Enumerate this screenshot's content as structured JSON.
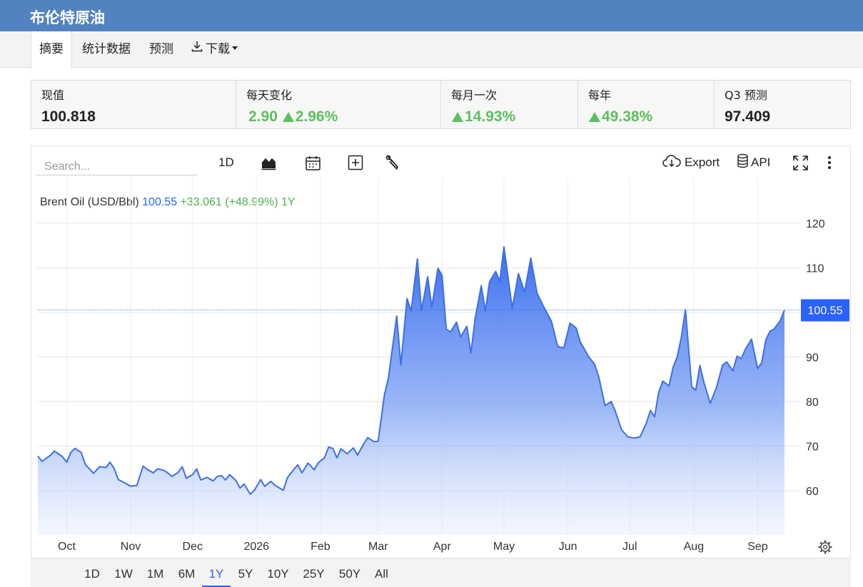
{
  "title": "布伦特原油",
  "tabs": [
    {
      "label": "摘要",
      "active": true
    },
    {
      "label": "统计数据"
    },
    {
      "label": "预测"
    },
    {
      "label": "下载",
      "icon": "download-icon",
      "has_dropdown": true
    }
  ],
  "stats": [
    {
      "label": "现值",
      "value": "100.818"
    },
    {
      "label": "每天变化",
      "value": "2.90",
      "value2": "2.96%",
      "direction": "up"
    },
    {
      "label": "每月一次",
      "value": "14.93%",
      "direction": "up"
    },
    {
      "label": "每年",
      "value": "49.38%",
      "direction": "up"
    },
    {
      "label": "Q3 预测",
      "value": "97.409"
    }
  ],
  "toolbar": {
    "search_placeholder": "Search...",
    "interval": "1D",
    "chart_type_icon": "area-chart-icon",
    "calendar_icon": "calendar-icon",
    "compare_icon": "plus-square-icon",
    "settings_icon": "wrench-icon",
    "export_label": "Export",
    "export_icon": "cloud-download-icon",
    "api_label": "API",
    "api_icon": "database-icon",
    "fullscreen_icon": "fullscreen-icon",
    "more_icon": "more-vertical-icon"
  },
  "legend": {
    "name": "Brent Oil (USD/Bbl)",
    "last": "100.55",
    "change": "+33.061",
    "change_pct": "(+48.99%)",
    "period": "1Y"
  },
  "ranges": [
    "1D",
    "1W",
    "1M",
    "6M",
    "1Y",
    "5Y",
    "10Y",
    "25Y",
    "50Y",
    "All"
  ],
  "active_range": "1Y",
  "colors": {
    "header": "#5283c0",
    "line": "#3d6fe3",
    "price_tag": "#2962ff",
    "positive": "#5cc05c"
  },
  "chart_data": {
    "type": "area",
    "series_name": "Brent Oil (USD/Bbl)",
    "x_range": [
      "2025-09-17",
      "2026-09-14"
    ],
    "x_ticks": [
      {
        "label": "Oct",
        "date": "2025-10-01"
      },
      {
        "label": "Nov",
        "date": "2025-11-01"
      },
      {
        "label": "Dec",
        "date": "2025-12-01"
      },
      {
        "label": "2026",
        "date": "2026-01-01"
      },
      {
        "label": "Feb",
        "date": "2026-02-01"
      },
      {
        "label": "Mar",
        "date": "2026-03-01"
      },
      {
        "label": "Apr",
        "date": "2026-04-01"
      },
      {
        "label": "May",
        "date": "2026-05-01"
      },
      {
        "label": "Jun",
        "date": "2026-06-01"
      },
      {
        "label": "Jul",
        "date": "2026-07-01"
      },
      {
        "label": "Aug",
        "date": "2026-08-01"
      },
      {
        "label": "Sep",
        "date": "2026-09-01"
      }
    ],
    "y_ticks": [
      60,
      70,
      80,
      90,
      100,
      110,
      120
    ],
    "y_tick_labels": [
      "60",
      "70",
      "80",
      "90",
      "110",
      "120"
    ],
    "ylim": [
      50.8,
      126.3
    ],
    "last_value": 100.55,
    "last_label": "100.55",
    "grid": true,
    "points": [
      [
        "2025-09-17",
        67.8
      ],
      [
        "2025-09-19",
        66.6
      ],
      [
        "2025-09-23",
        67.9
      ],
      [
        "2025-09-25",
        68.9
      ],
      [
        "2025-09-29",
        67.6
      ],
      [
        "2025-10-01",
        66.4
      ],
      [
        "2025-10-03",
        68.6
      ],
      [
        "2025-10-05",
        69.5
      ],
      [
        "2025-10-08",
        68.6
      ],
      [
        "2025-10-10",
        65.9
      ],
      [
        "2025-10-14",
        63.9
      ],
      [
        "2025-10-17",
        65.4
      ],
      [
        "2025-10-20",
        65.2
      ],
      [
        "2025-10-22",
        66.4
      ],
      [
        "2025-10-24",
        65.0
      ],
      [
        "2025-10-26",
        62.5
      ],
      [
        "2025-10-29",
        61.8
      ],
      [
        "2025-11-01",
        61.0
      ],
      [
        "2025-11-04",
        61.2
      ],
      [
        "2025-11-07",
        65.5
      ],
      [
        "2025-11-09",
        64.8
      ],
      [
        "2025-11-12",
        64.0
      ],
      [
        "2025-11-14",
        64.9
      ],
      [
        "2025-11-17",
        64.6
      ],
      [
        "2025-11-19",
        64.0
      ],
      [
        "2025-11-21",
        63.2
      ],
      [
        "2025-11-24",
        64.1
      ],
      [
        "2025-11-26",
        65.4
      ],
      [
        "2025-11-28",
        62.8
      ],
      [
        "2025-12-01",
        63.6
      ],
      [
        "2025-12-03",
        64.9
      ],
      [
        "2025-12-05",
        62.4
      ],
      [
        "2025-12-08",
        63.0
      ],
      [
        "2025-12-11",
        62.2
      ],
      [
        "2025-12-13",
        63.2
      ],
      [
        "2025-12-15",
        63.4
      ],
      [
        "2025-12-17",
        62.4
      ],
      [
        "2025-12-19",
        63.6
      ],
      [
        "2025-12-22",
        62.3
      ],
      [
        "2025-12-24",
        60.6
      ],
      [
        "2025-12-26",
        61.5
      ],
      [
        "2025-12-29",
        59.2
      ],
      [
        "2025-12-31",
        60.1
      ],
      [
        "2026-01-03",
        62.5
      ],
      [
        "2026-01-05",
        61.0
      ],
      [
        "2026-01-08",
        62.1
      ],
      [
        "2026-01-10",
        61.2
      ],
      [
        "2026-01-14",
        60.1
      ],
      [
        "2026-01-16",
        62.9
      ],
      [
        "2026-01-19",
        64.7
      ],
      [
        "2026-01-21",
        65.8
      ],
      [
        "2026-01-23",
        64.0
      ],
      [
        "2026-01-26",
        66.2
      ],
      [
        "2026-01-29",
        64.7
      ],
      [
        "2026-01-31",
        66.3
      ],
      [
        "2026-02-03",
        67.4
      ],
      [
        "2026-02-05",
        69.8
      ],
      [
        "2026-02-07",
        69.5
      ],
      [
        "2026-02-09",
        67.4
      ],
      [
        "2026-02-11",
        69.4
      ],
      [
        "2026-02-14",
        68.3
      ],
      [
        "2026-02-17",
        69.6
      ],
      [
        "2026-02-19",
        68.0
      ],
      [
        "2026-02-22",
        70.5
      ],
      [
        "2026-02-24",
        71.9
      ],
      [
        "2026-02-27",
        71.0
      ],
      [
        "2026-03-01",
        71.1
      ],
      [
        "2026-03-04",
        81.4
      ],
      [
        "2026-03-06",
        85.4
      ],
      [
        "2026-03-10",
        99.2
      ],
      [
        "2026-03-12",
        88.2
      ],
      [
        "2026-03-15",
        103.1
      ],
      [
        "2026-03-17",
        100.3
      ],
      [
        "2026-03-20",
        112.0
      ],
      [
        "2026-03-22",
        100.4
      ],
      [
        "2026-03-25",
        108.0
      ],
      [
        "2026-03-27",
        101.2
      ],
      [
        "2026-03-30",
        109.9
      ],
      [
        "2026-04-01",
        108.3
      ],
      [
        "2026-04-03",
        96.3
      ],
      [
        "2026-04-05",
        95.6
      ],
      [
        "2026-04-08",
        97.8
      ],
      [
        "2026-04-10",
        94.5
      ],
      [
        "2026-04-13",
        96.9
      ],
      [
        "2026-04-15",
        90.9
      ],
      [
        "2026-04-17",
        98.6
      ],
      [
        "2026-04-20",
        106.0
      ],
      [
        "2026-04-22",
        100.3
      ],
      [
        "2026-04-24",
        106.9
      ],
      [
        "2026-04-27",
        109.2
      ],
      [
        "2026-04-29",
        107.0
      ],
      [
        "2026-05-01",
        114.7
      ],
      [
        "2026-05-05",
        100.9
      ],
      [
        "2026-05-08",
        108.7
      ],
      [
        "2026-05-11",
        104.6
      ],
      [
        "2026-05-14",
        112.2
      ],
      [
        "2026-05-17",
        104.4
      ],
      [
        "2026-05-20",
        101.5
      ],
      [
        "2026-05-24",
        98.0
      ],
      [
        "2026-05-27",
        92.4
      ],
      [
        "2026-05-30",
        92.0
      ],
      [
        "2026-06-02",
        97.6
      ],
      [
        "2026-06-05",
        96.5
      ],
      [
        "2026-06-07",
        93.4
      ],
      [
        "2026-06-11",
        90.1
      ],
      [
        "2026-06-14",
        88.3
      ],
      [
        "2026-06-16",
        85.5
      ],
      [
        "2026-06-19",
        79.1
      ],
      [
        "2026-06-22",
        80.0
      ],
      [
        "2026-06-24",
        77.8
      ],
      [
        "2026-06-27",
        73.7
      ],
      [
        "2026-06-30",
        72.1
      ],
      [
        "2026-07-03",
        71.8
      ],
      [
        "2026-07-06",
        72.1
      ],
      [
        "2026-07-09",
        75.1
      ],
      [
        "2026-07-11",
        78.0
      ],
      [
        "2026-07-13",
        76.6
      ],
      [
        "2026-07-15",
        82.0
      ],
      [
        "2026-07-17",
        84.6
      ],
      [
        "2026-07-20",
        83.5
      ],
      [
        "2026-07-22",
        87.7
      ],
      [
        "2026-07-24",
        90.0
      ],
      [
        "2026-07-26",
        94.4
      ],
      [
        "2026-07-28",
        100.6
      ],
      [
        "2026-07-31",
        83.3
      ],
      [
        "2026-08-02",
        82.6
      ],
      [
        "2026-08-04",
        88.1
      ],
      [
        "2026-08-06",
        84.2
      ],
      [
        "2026-08-09",
        79.6
      ],
      [
        "2026-08-12",
        83.1
      ],
      [
        "2026-08-15",
        88.2
      ],
      [
        "2026-08-17",
        88.9
      ],
      [
        "2026-08-20",
        86.9
      ],
      [
        "2026-08-22",
        90.2
      ],
      [
        "2026-08-24",
        89.6
      ],
      [
        "2026-08-26",
        91.7
      ],
      [
        "2026-08-29",
        94.0
      ],
      [
        "2026-09-01",
        87.4
      ],
      [
        "2026-09-03",
        88.8
      ],
      [
        "2026-09-05",
        93.9
      ],
      [
        "2026-09-07",
        95.8
      ],
      [
        "2026-09-09",
        96.3
      ],
      [
        "2026-09-12",
        98.2
      ],
      [
        "2026-09-14",
        100.55
      ]
    ]
  }
}
